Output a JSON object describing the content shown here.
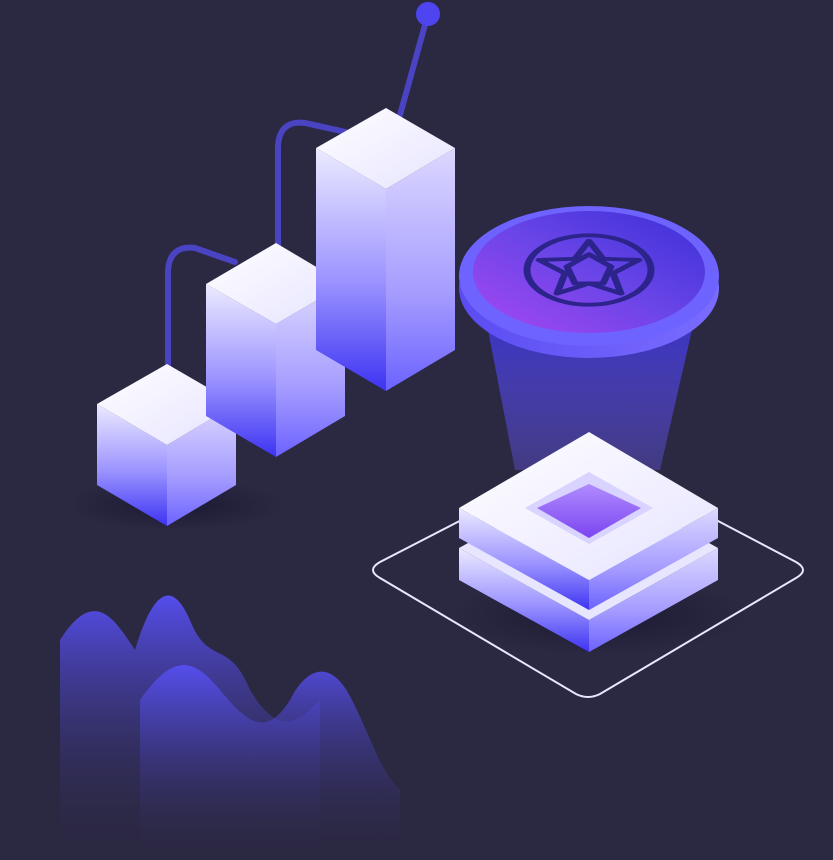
{
  "colors": {
    "background": "#2b2842",
    "accent": "#4f45f0",
    "accent_light": "#b9b2ff",
    "violet": "#8e4bf5",
    "face_top": "#f4f3ff",
    "line": "#4a43c2"
  },
  "illustration": {
    "bars": 3,
    "coin_icon": "geometric-star-icon"
  }
}
